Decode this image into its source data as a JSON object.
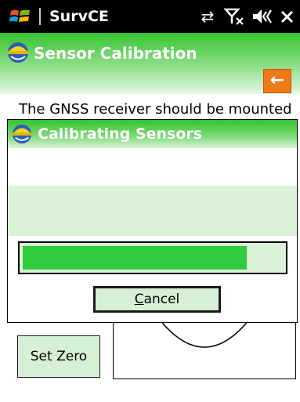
{
  "status_bar": {
    "app_title": "SurvCE",
    "icons": [
      "windows-logo",
      "connectivity-icon",
      "no-signal-icon",
      "volume-icon",
      "close-icon"
    ]
  },
  "header": {
    "title": "Sensor Calibration",
    "back_label": "←"
  },
  "instruction": "The GNSS receiver should be mounted",
  "dialog": {
    "title": "Calibrating Sensors",
    "progress": 0.86,
    "cancel_label_first": "C",
    "cancel_label_rest": "ancel"
  },
  "set_zero_label": "Set Zero",
  "colors": {
    "header_green": "#36c42f",
    "progress_green": "#2fcd3e",
    "back_orange": "#f07a18",
    "button_fill": "#d6f0d6"
  }
}
